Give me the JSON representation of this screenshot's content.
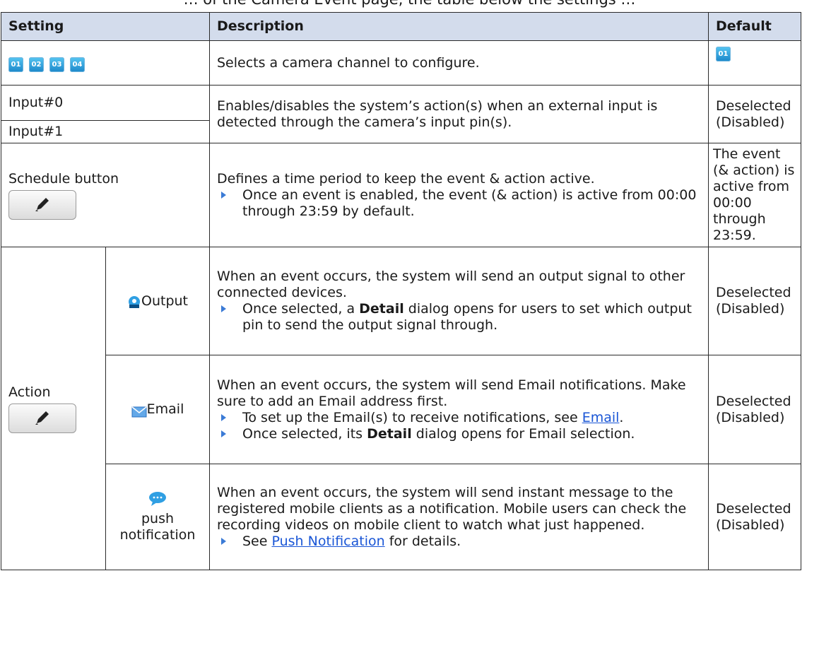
{
  "top_text": "… of the Camera Event page, the table below the settings …",
  "headers": {
    "setting": "Setting",
    "description": "Description",
    "default": "Default"
  },
  "channels": [
    "01",
    "02",
    "03",
    "04"
  ],
  "default_channel": "01",
  "rows": {
    "channel_desc": "Selects a camera channel to configure.",
    "input0": "Input#0",
    "input1": "Input#1",
    "input_desc": "Enables/disables the system’s action(s) when an external input is detected through the camera’s input pin(s).",
    "deselected": "Deselected (Disabled)",
    "schedule_label": "Schedule button",
    "schedule_desc": "Defines a time period to keep the event & action active.",
    "schedule_bullet": "Once an event is enabled, the event (& action) is active from 00:00 through 23:59 by default.",
    "schedule_default": "The event (& action) is active from 00:00 through 23:59.",
    "action_label": "Action",
    "output_label": "Output",
    "output_desc": "When an event occurs, the system will send an output signal to other connected devices.",
    "output_bullet_pre": "Once selected, a ",
    "output_bullet_bold": "Detail",
    "output_bullet_post": " dialog opens for users to set which output pin to send the output signal through.",
    "email_label": "Email",
    "email_desc": "When an event occurs, the system will send Email notifications. Make sure to add an Email address first.",
    "email_bullet1_pre": "To set up the Email(s) to receive notifications, see ",
    "email_bullet1_link": "Email",
    "email_bullet1_post": ".",
    "email_bullet2_pre": "Once selected, its ",
    "email_bullet2_bold": "Detail",
    "email_bullet2_post": " dialog opens for Email selection.",
    "push_label": "push notification",
    "push_desc": "When an event occurs, the system will send instant message to the registered mobile clients as a notification. Mobile users can check the recording videos on mobile client to watch what just happened.",
    "push_bullet_pre": "See ",
    "push_bullet_link": "Push Notification",
    "push_bullet_post": " for details."
  },
  "icons": {
    "edit": "pencil-icon",
    "output": "output-icon",
    "email": "envelope-icon",
    "push": "chat-bubble-icon",
    "bullet": "triangle-bullet-icon"
  },
  "colors": {
    "header_bg": "#d3dcec",
    "link": "#1a56d6",
    "bullet": "#3b7bd6",
    "channel": "#1b86c9"
  }
}
